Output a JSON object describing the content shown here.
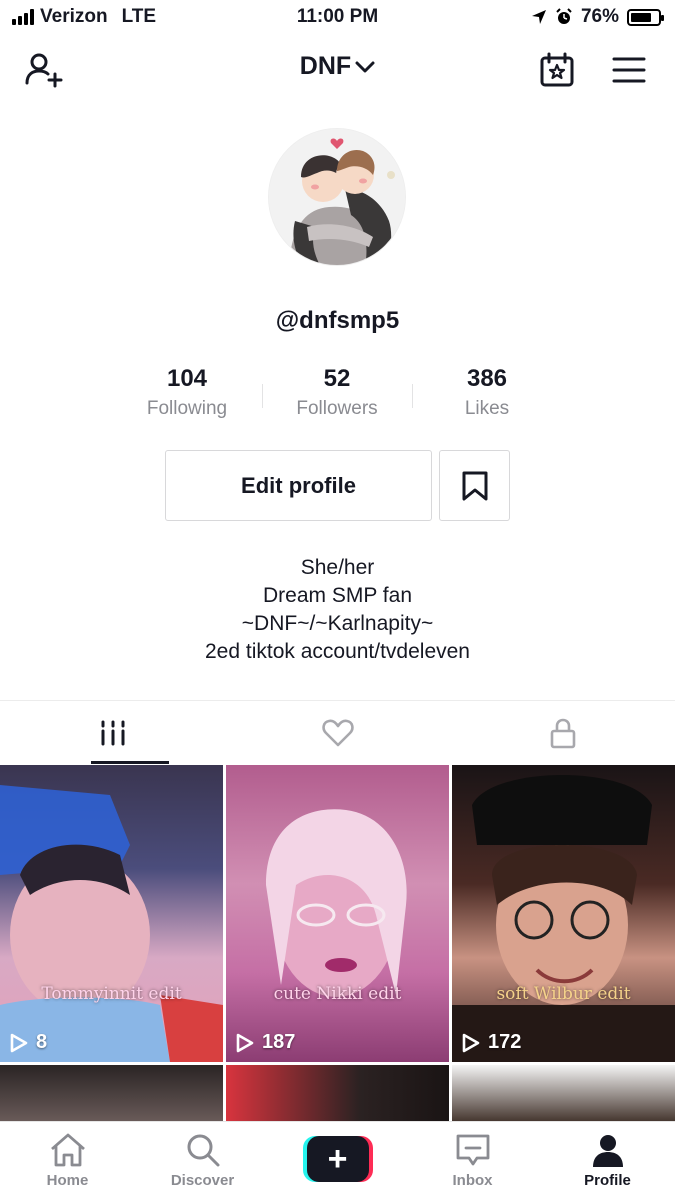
{
  "status_bar": {
    "carrier": "Verizon",
    "network": "LTE",
    "time": "11:00 PM",
    "battery": "76%",
    "battery_level": 0.76
  },
  "header": {
    "username": "DNF",
    "icons": [
      "add-user-icon",
      "calendar-star-icon",
      "hamburger-menu-icon"
    ]
  },
  "profile": {
    "handle": "@dnfsmp5",
    "stats": [
      {
        "value": "104",
        "label": "Following"
      },
      {
        "value": "52",
        "label": "Followers"
      },
      {
        "value": "386",
        "label": "Likes"
      }
    ],
    "edit_label": "Edit profile",
    "bio": [
      "She/her",
      "Dream SMP fan",
      "~DNF~/~Karlnapity~",
      "2ed tiktok account/tvdeleven"
    ]
  },
  "tabs": [
    {
      "icon": "grid-icon",
      "active": true
    },
    {
      "icon": "heart-icon",
      "active": false
    },
    {
      "icon": "lock-icon",
      "active": false
    }
  ],
  "videos": [
    {
      "caption": "Tommyinnit edit",
      "views": "8"
    },
    {
      "caption": "cute Nikki edit",
      "views": "187"
    },
    {
      "caption": "soft Wilbur edit",
      "views": "172"
    }
  ],
  "bottom_nav": {
    "items": [
      {
        "label": "Home",
        "icon": "home-icon"
      },
      {
        "label": "Discover",
        "icon": "search-icon"
      },
      {
        "label": "",
        "icon": "plus-icon"
      },
      {
        "label": "Inbox",
        "icon": "inbox-icon"
      },
      {
        "label": "Profile",
        "icon": "profile-icon"
      }
    ]
  },
  "colors": {
    "text": "#161823",
    "muted": "#8a8b91",
    "brand_cyan": "#25f4ee",
    "brand_red": "#fe2c55"
  }
}
